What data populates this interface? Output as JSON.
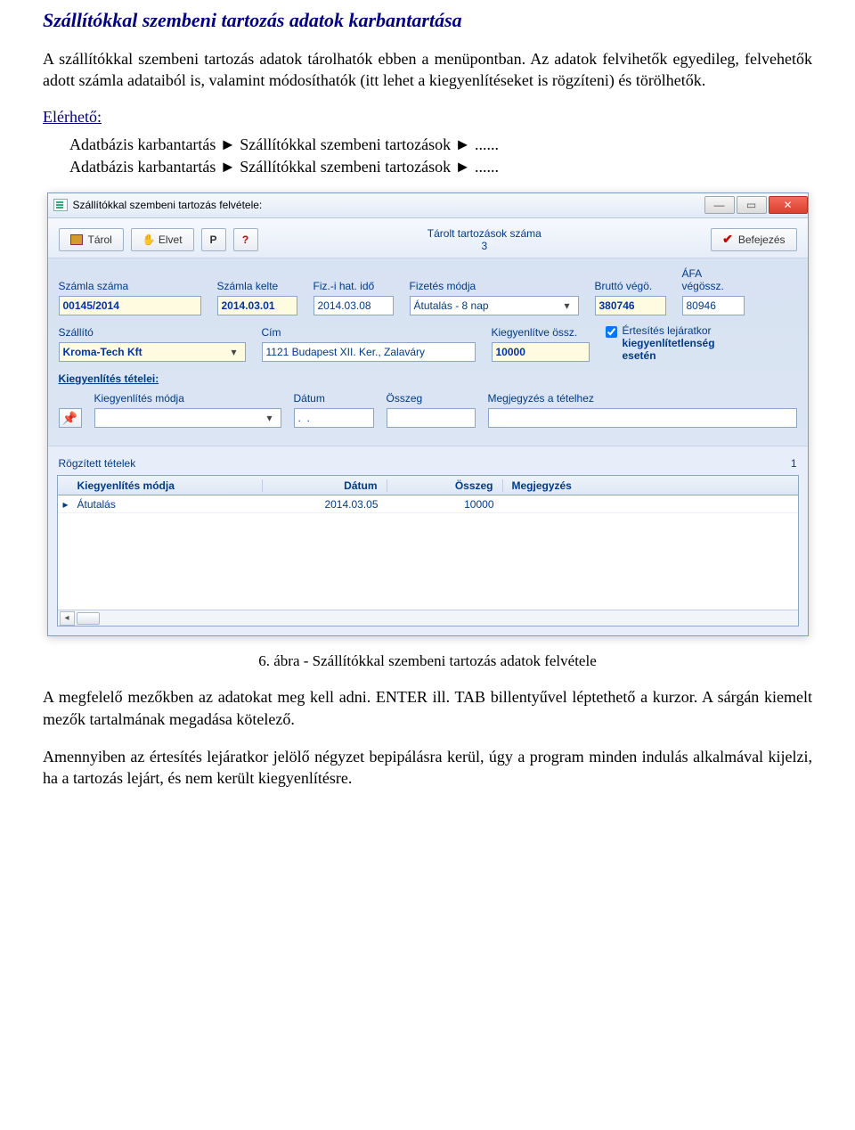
{
  "doc": {
    "title": "Szállítókkal szembeni tartozás adatok karbantartása",
    "p1": "A szállítókkal szembeni tartozás adatok tárolhatók ebben a menüpontban. Az adatok felvihetők egyedileg, felvehetők adott számla adataiból is, valamint módosíthatók (itt lehet a kiegyenlítéseket is rögzíteni) és törölhetők.",
    "subhead": "Elérhető:",
    "nav1": "Adatbázis karbantartás ► Szállítókkal szembeni tartozások ► ......",
    "nav2": "Adatbázis karbantartás ► Szállítókkal szembeni tartozások ► ......",
    "caption": "6. ábra - Szállítókkal szembeni tartozás adatok felvétele",
    "p2": "A megfelelő mezőkben az adatokat meg kell adni. ENTER ill. TAB billentyűvel léptethető a kurzor. A sárgán kiemelt mezők tartalmának megadása kötelező.",
    "p3": "Amennyiben az értesítés lejáratkor jelölő négyzet bepipálásra kerül, úgy a program minden indulás alkalmával kijelzi, ha a tartozás lejárt, és nem került kiegyenlítésre."
  },
  "window": {
    "title": "Szállítókkal szembeni tartozás felvétele:",
    "toolbar": {
      "tarol": "Tárol",
      "elvet": "Elvet",
      "p": "P",
      "q": "?",
      "counter_label": "Tárolt tartozások száma",
      "counter_value": "3",
      "befejezes": "Befejezés"
    },
    "fields": {
      "szamla_szama_lbl": "Számla száma",
      "szamla_szama": "00145/2014",
      "szamla_kelte_lbl": "Számla kelte",
      "szamla_kelte": "2014.03.01",
      "fiz_hat_lbl": "Fiz.-i hat. idő",
      "fiz_hat": "2014.03.08",
      "fiz_mod_lbl": "Fizetés módja",
      "fiz_mod": "Átutalás -  8 nap",
      "brutto_lbl": "Bruttó végö.",
      "brutto": "380746",
      "afa_lbl": "ÁFA végössz.",
      "afa": "80946",
      "szallito_lbl": "Szállító",
      "szallito": "Kroma-Tech Kft",
      "cim_lbl": "Cím",
      "cim": "1121 Budapest XII. Ker., Zalaváry",
      "kiegy_ossz_lbl": "Kiegyenlítve össz.",
      "kiegy_ossz": "10000",
      "ertesites_l1": "Értesítés lejáratkor",
      "ertesites_l2": "kiegyenlítetlenség",
      "ertesites_l3": "esetén"
    },
    "section": "Kiegyenlítés tételei:",
    "detail": {
      "mod_lbl": "Kiegyenlítés módja",
      "datum_lbl": "Dátum",
      "datum_ph": ".  .",
      "osszeg_lbl": "Összeg",
      "megj_lbl": "Megjegyzés a tételhez"
    },
    "grid": {
      "title": "Rögzített tételek",
      "count": "1",
      "headers": {
        "c1": "Kiegyenlítés módja",
        "c2": "Dátum",
        "c3": "Összeg",
        "c4": "Megjegyzés"
      },
      "rows": [
        {
          "c1": "Átutalás",
          "c2": "2014.03.05",
          "c3": "10000",
          "c4": ""
        }
      ]
    }
  }
}
